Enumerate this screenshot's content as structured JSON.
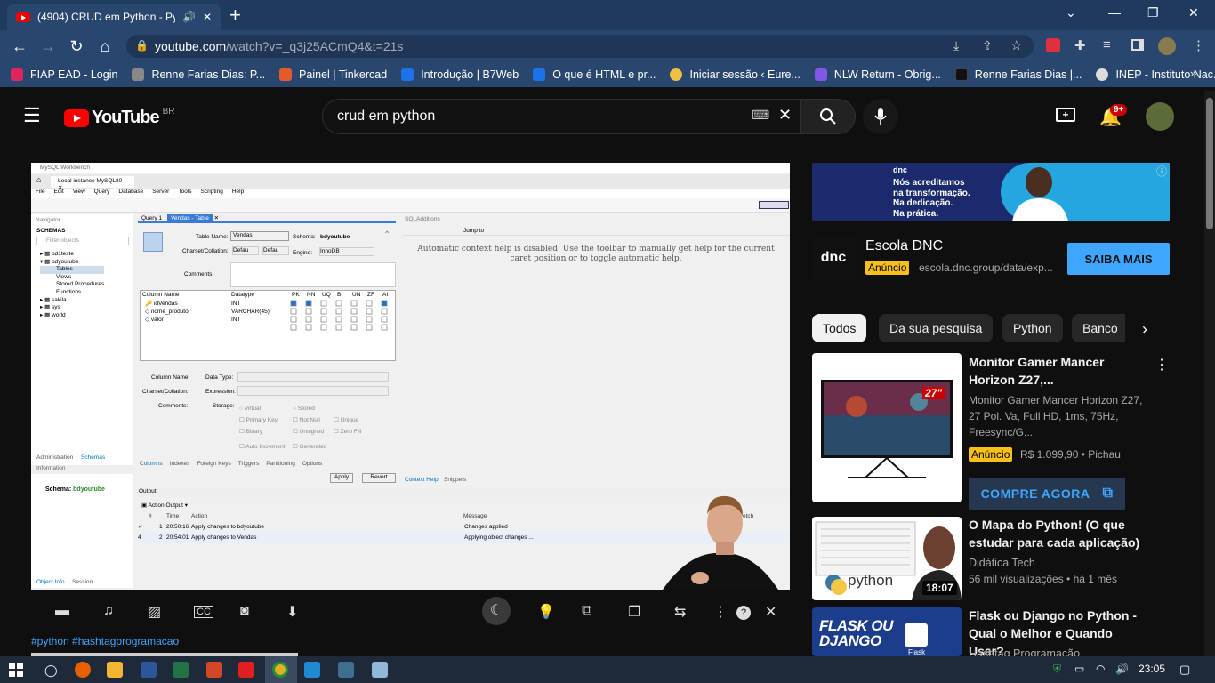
{
  "browser": {
    "tab_title": "(4904) CRUD em Python - Py",
    "url_host": "youtube.com",
    "url_rest": "/watch?v=_q3j25ACmQ4&t=21s",
    "bookmarks": [
      {
        "label": "FIAP EAD - Login",
        "color": "#e0245e"
      },
      {
        "label": "Renne Farias Dias: P...",
        "color": "#888888"
      },
      {
        "label": "Painel | Tinkercad",
        "color": "#e25b2a"
      },
      {
        "label": "Introdução | B7Web",
        "color": "#1a73e8"
      },
      {
        "label": "O que é HTML e pr...",
        "color": "#1a73e8"
      },
      {
        "label": "Iniciar sessão ‹ Eure...",
        "color": "#f0c040"
      },
      {
        "label": "NLW Return - Obrig...",
        "color": "#8257e5"
      },
      {
        "label": "Renne Farias Dias |...",
        "color": "#111111"
      },
      {
        "label": "INEP - Instituto Nac...",
        "color": "#dddddd"
      }
    ]
  },
  "youtube": {
    "logo_text": "YouTube",
    "region": "BR",
    "search_value": "crud em python",
    "notifications_badge": "9+",
    "hashtags": "#python #hashtagprogramacao"
  },
  "workbench": {
    "app_title": "MySQL Workbench",
    "instance_tab": "Local instance MySQL80",
    "menu": [
      "File",
      "Edit",
      "View",
      "Query",
      "Database",
      "Server",
      "Tools",
      "Scripting",
      "Help"
    ],
    "navigator": "Navigator",
    "schemas_label": "SCHEMAS",
    "filter_placeholder": "Filter objects",
    "tree": [
      "bd1teste",
      "bdyoutube",
      "Tables",
      "Views",
      "Stored Procedures",
      "Functions",
      "sakila",
      "sys",
      "world"
    ],
    "tab_query": "Query 1",
    "tab_table": "Vendas - Table",
    "sql_additions": "SQLAdditions",
    "table_name_label": "Table Name:",
    "table_name_value": "Vendas",
    "schema_label": "Schema:",
    "schema_value": "bdyoutube",
    "charset_label": "Charset/Collation:",
    "charset_value": "Defau",
    "collation_value": "Defau",
    "engine_label": "Engine:",
    "engine_value": "InnoDB",
    "comments_label": "Comments:",
    "jump_to": "Jump to",
    "context_help": "Automatic context help is disabled. Use the toolbar to manually get help for the current caret position or to toggle automatic help.",
    "col_headers": [
      "Column Name",
      "Datatype",
      "PK",
      "NN",
      "UQ",
      "B",
      "UN",
      "ZF",
      "AI"
    ],
    "columns": [
      {
        "name": "idVendas",
        "type": "INT"
      },
      {
        "name": "nome_produto",
        "type": "VARCHAR(45)"
      },
      {
        "name": "valor",
        "type": "INT"
      }
    ],
    "detail": {
      "column_name": "Column Name:",
      "data_type": "Data Type:",
      "charset": "Charset/Collation:",
      "expression": "Expression:",
      "comments": "Comments:",
      "storage": "Storage:",
      "opts": [
        "Virtual",
        "Stored",
        "Primary Key",
        "Not Null",
        "Unique",
        "Binary",
        "Unsigned",
        "Zero Fill",
        "Auto Increment",
        "Generated"
      ]
    },
    "bottom_tabs": [
      "Columns",
      "Indexes",
      "Foreign Keys",
      "Triggers",
      "Partitioning",
      "Options"
    ],
    "apply": "Apply",
    "revert": "Revert",
    "help_tabs": [
      "Context Help",
      "Snippets"
    ],
    "admin_tabs": [
      "Administration",
      "Schemas"
    ],
    "information": "Information",
    "info_schema_label": "Schema:",
    "info_schema_value": "bdyoutube",
    "object_tabs": [
      "Object Info",
      "Session"
    ],
    "output": "Output",
    "action_output": "Action Output",
    "out_headers": [
      "#",
      "Time",
      "Action",
      "Message",
      "Duration / Fetch"
    ],
    "out_rows": [
      {
        "n": "1",
        "time": "20:50:16",
        "action": "Apply changes to bdyoutube",
        "message": "Changes applied"
      },
      {
        "n": "2",
        "time": "20:54:01",
        "action": "Apply changes to Vendas",
        "message": "Applying object changes ..."
      }
    ]
  },
  "ad": {
    "brand_small": "dnc",
    "slogan": [
      "Nós acreditamos",
      "na transformação.",
      "Na dedicação.",
      "Na prática."
    ],
    "name": "Escola DNC",
    "badge": "Anúncio",
    "url": "escola.dnc.group/data/exp...",
    "cta": "SAIBA MAIS"
  },
  "chips": [
    "Todos",
    "Da sua pesquisa",
    "Python",
    "Banco"
  ],
  "videos": [
    {
      "title": "Monitor Gamer Mancer Horizon Z27,...",
      "desc": "Monitor Gamer Mancer Horizon Z27, 27 Pol. Va, Full HD, 1ms, 75Hz, Freesync/G...",
      "badge": "Anúncio",
      "price": "R$ 1.099,90 • Pichau",
      "cta": "COMPRE AGORA",
      "thumb_label": "27\""
    },
    {
      "title": "O Mapa do Python! (O que estudar para cada aplicação)",
      "channel": "Didática Tech",
      "meta": "56 mil visualizações • há 1 mês",
      "duration": "18:07",
      "thumb_label": "python"
    },
    {
      "title": "Flask ou Django no Python - Qual o Melhor e Quando Usar?",
      "channel": "Hashtag Programação",
      "thumb_label": "FLASK OU DJANGO",
      "thumb_sub": "Flask"
    }
  ],
  "taskbar": {
    "time": "23:05"
  }
}
